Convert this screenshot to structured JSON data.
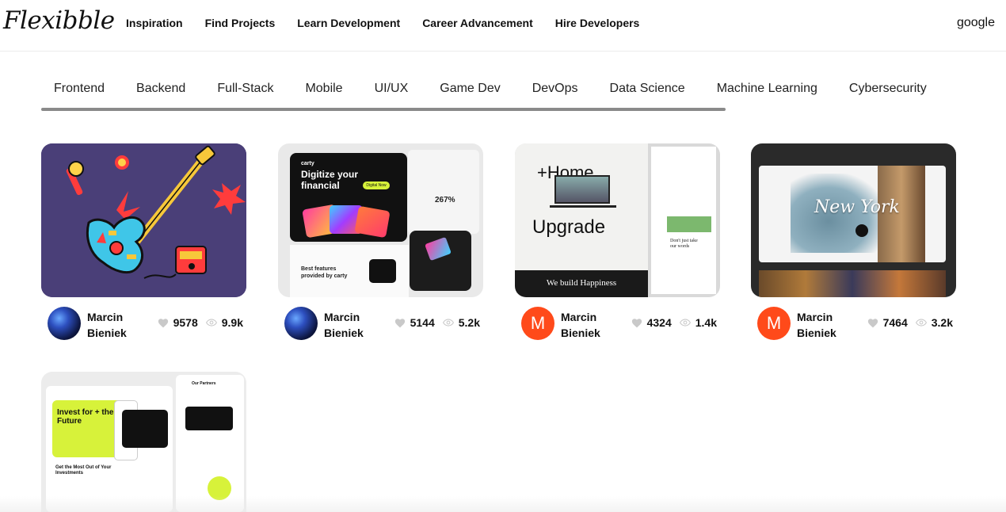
{
  "nav": {
    "logo": "Flexibble",
    "links": [
      "Inspiration",
      "Find Projects",
      "Learn Development",
      "Career Advancement",
      "Hire Developers"
    ],
    "user": "google"
  },
  "categories": [
    "Frontend",
    "Backend",
    "Full-Stack",
    "Mobile",
    "UI/UX",
    "Game Dev",
    "DevOps",
    "Data Science",
    "Machine Learning",
    "Cybersecurity"
  ],
  "projects": [
    {
      "author_first": "Marcin",
      "author_last": "Bieniek",
      "avatar": "photo",
      "likes": "9578",
      "views": "9.9k"
    },
    {
      "author_first": "Marcin",
      "author_last": "Bieniek",
      "avatar": "photo",
      "likes": "5144",
      "views": "5.2k",
      "thumb": {
        "brand": "carty",
        "headline": "Digitize your financial",
        "cta": "Digital Now",
        "stat": "267%",
        "features": "Best features provided by carty"
      }
    },
    {
      "author_first": "Marcin",
      "author_last": "Bieniek",
      "avatar": "M",
      "likes": "4324",
      "views": "1.4k",
      "thumb": {
        "headline_1": "+Home",
        "headline_2": "Upgrade",
        "tagline": "We build Happiness",
        "side": "Don't just take our words"
      }
    },
    {
      "author_first": "Marcin",
      "author_last": "Bieniek",
      "avatar": "M",
      "likes": "7464",
      "views": "3.2k",
      "thumb": {
        "title": "New York"
      }
    },
    {
      "thumb": {
        "headline": "Invest for + the Future",
        "sub": "Get the Most Out of Your Investments",
        "partners": "Our Partners"
      }
    }
  ],
  "colors": {
    "accent_orange": "#ff4a1a",
    "lime": "#d7f23a",
    "guitar_bg": "#4a3f78"
  }
}
